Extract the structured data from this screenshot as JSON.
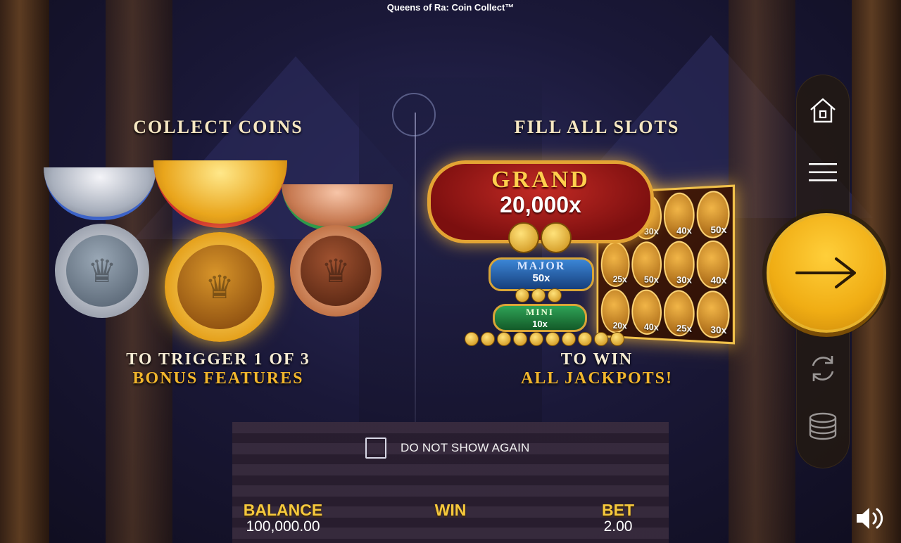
{
  "game": {
    "title": "Queens of Ra: Coin Collect™"
  },
  "left_panel": {
    "heading": "COLLECT COINS",
    "caption_line1": "TO TRIGGER 1 OF 3",
    "caption_line2": "BONUS FEATURES"
  },
  "right_panel": {
    "heading": "FILL ALL SLOTS",
    "grand_label": "GRAND",
    "grand_value": "20,000x",
    "major_label": "MAJOR",
    "major_value": "50x",
    "mini_label": "MINI",
    "mini_value": "10x",
    "reel_values": [
      "",
      "30x",
      "40x",
      "50x",
      "25x",
      "50x",
      "30x",
      "40x",
      "20x",
      "40x",
      "25x",
      "30x"
    ],
    "caption_line1": "TO WIN",
    "caption_line2": "ALL JACKPOTS!"
  },
  "dont_show": {
    "label": "DO NOT SHOW AGAIN",
    "checked": false
  },
  "status": {
    "balance_label": "BALANCE",
    "balance_value": "100,000.00",
    "win_label": "WIN",
    "win_value": "",
    "bet_label": "BET",
    "bet_value": "2.00"
  },
  "controls": {
    "home_icon": "home-icon",
    "menu_icon": "hamburger-menu-icon",
    "continue_icon": "arrow-right-icon",
    "autoplay_icon": "autoplay-cycle-icon",
    "stake_icon": "coin-stack-icon",
    "sound_icon": "speaker-icon"
  },
  "colors": {
    "gold": "#f6c93c",
    "spin_button": "#f0ad14",
    "grand_red": "#9c1414",
    "major_blue": "#1f5ea8",
    "mini_green": "#1f7a3a"
  }
}
